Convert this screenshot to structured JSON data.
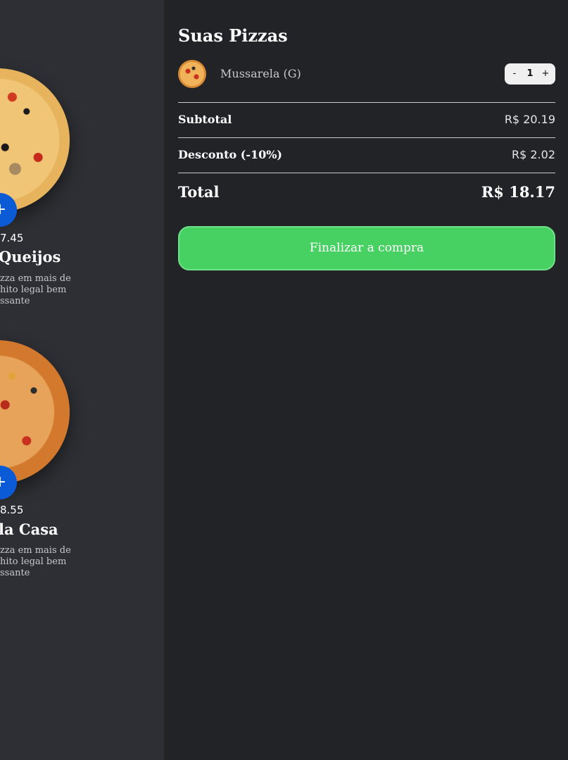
{
  "products": [
    {
      "price": "7.45",
      "name": "Queijos",
      "description_lines": [
        "zza em mais de",
        "hito legal bem",
        "ssante"
      ],
      "add_label": "+"
    },
    {
      "price": "8.55",
      "name": "la Casa",
      "description_lines": [
        "zza em mais de",
        "hito legal bem",
        "ssante"
      ],
      "add_label": "+"
    }
  ],
  "cart": {
    "title": "Suas Pizzas",
    "items": [
      {
        "name": "Mussarela (G)",
        "quantity": "1",
        "minus": "-",
        "plus": "+"
      }
    ],
    "subtotal": {
      "label": "Subtotal",
      "value": "R$ 20.19"
    },
    "discount": {
      "label": "Desconto (-10%)",
      "value": "R$ 2.02"
    },
    "total": {
      "label": "Total",
      "value": "R$ 18.17"
    },
    "checkout_label": "Finalizar a compra"
  },
  "colors": {
    "background": "#222327",
    "menu_background": "#2e2f34",
    "accent_blue": "#0b5ad6",
    "checkout_green": "#48d163"
  }
}
